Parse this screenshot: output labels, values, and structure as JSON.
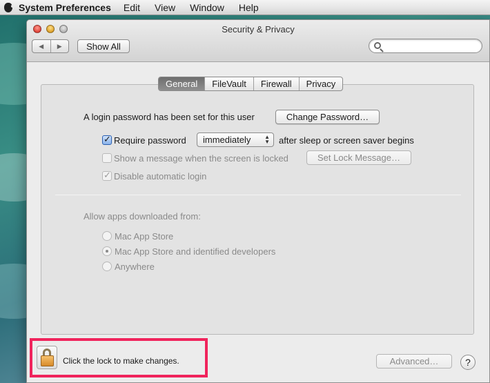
{
  "menubar": {
    "app_name": "System Preferences",
    "items": [
      "Edit",
      "View",
      "Window",
      "Help"
    ]
  },
  "window": {
    "title": "Security & Privacy",
    "show_all_label": "Show All",
    "search_placeholder": ""
  },
  "tabs": [
    {
      "label": "General",
      "active": true
    },
    {
      "label": "FileVault",
      "active": false
    },
    {
      "label": "Firewall",
      "active": false
    },
    {
      "label": "Privacy",
      "active": false
    }
  ],
  "general": {
    "login_password_text": "A login password has been set for this user",
    "change_password_label": "Change Password…",
    "require_password_label": "Require password",
    "require_password_checked": true,
    "require_password_delay": "immediately",
    "after_sleep_text": "after sleep or screen saver begins",
    "show_message_label": "Show a message when the screen is locked",
    "show_message_checked": false,
    "set_lock_message_label": "Set Lock Message…",
    "disable_auto_login_label": "Disable automatic login",
    "disable_auto_login_checked": true
  },
  "downloads": {
    "heading": "Allow apps downloaded from:",
    "options": [
      {
        "label": "Mac App Store",
        "selected": false
      },
      {
        "label": "Mac App Store and identified developers",
        "selected": true
      },
      {
        "label": "Anywhere",
        "selected": false
      }
    ]
  },
  "footer": {
    "lock_text": "Click the lock to make changes.",
    "advanced_label": "Advanced…",
    "help_label": "?"
  },
  "colors": {
    "highlight": "#f0245c",
    "active_tab": "#7a7a7a"
  }
}
